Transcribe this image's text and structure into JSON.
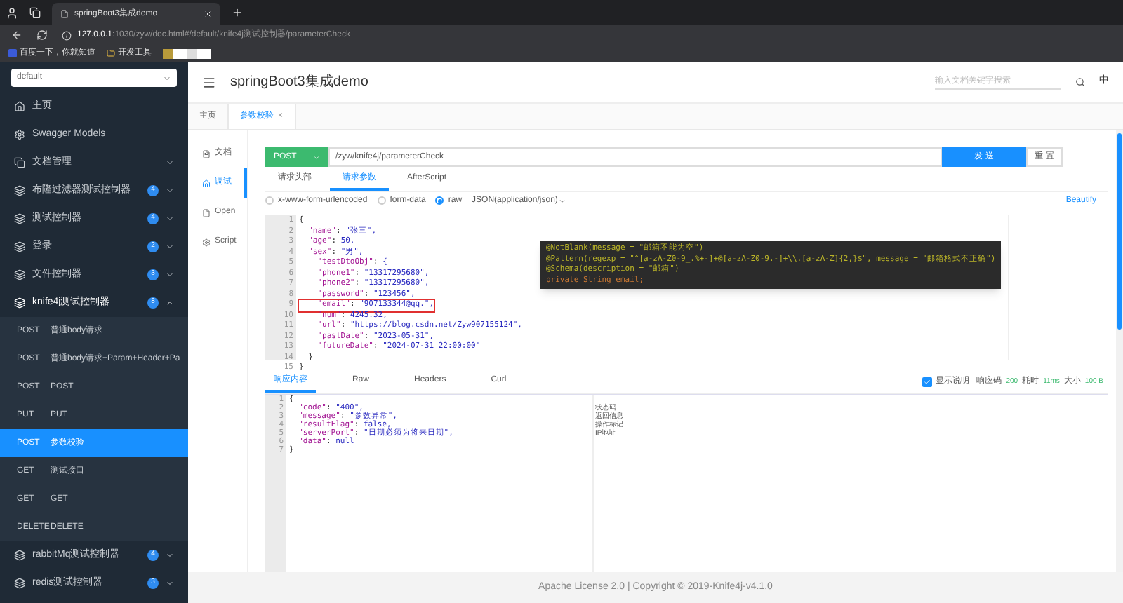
{
  "browser": {
    "tab_title": "springBoot3集成demo",
    "url_host": "127.0.0.1",
    "url_rest": ":1030/zyw/doc.html#/default/knife4j测试控制器/parameterCheck",
    "bookmarks": [
      "百度一下，你就知道",
      "开发工具"
    ]
  },
  "sidebar": {
    "group_select": "default",
    "items": [
      {
        "kind": "page",
        "label": "主页"
      },
      {
        "kind": "page",
        "label": "Swagger Models"
      },
      {
        "kind": "folder",
        "label": "文档管理",
        "expanded": false
      },
      {
        "kind": "group",
        "label": "布隆过滤器测试控制器",
        "badge": "4",
        "expanded": false
      },
      {
        "kind": "group",
        "label": "测试控制器",
        "badge": "4",
        "expanded": false
      },
      {
        "kind": "group",
        "label": "登录",
        "badge": "2",
        "expanded": false
      },
      {
        "kind": "group",
        "label": "文件控制器",
        "badge": "3",
        "expanded": false
      },
      {
        "kind": "group",
        "label": "knife4j测试控制器",
        "badge": "8",
        "expanded": true,
        "children": [
          {
            "method": "POST",
            "label": "普通body请求",
            "selected": false
          },
          {
            "method": "POST",
            "label": "普通body请求+Param+Header+Pa",
            "selected": false
          },
          {
            "method": "POST",
            "label": "POST",
            "selected": false
          },
          {
            "method": "PUT",
            "label": "PUT",
            "selected": false
          },
          {
            "method": "POST",
            "label": "参数校验",
            "selected": true
          },
          {
            "method": "GET",
            "label": "测试接口",
            "selected": false
          },
          {
            "method": "GET",
            "label": "GET",
            "selected": false
          },
          {
            "method": "DELETE",
            "label": "DELETE",
            "selected": false
          }
        ]
      },
      {
        "kind": "group",
        "label": "rabbitMq测试控制器",
        "badge": "4",
        "expanded": false
      },
      {
        "kind": "group",
        "label": "redis测试控制器",
        "badge": "3",
        "expanded": false
      }
    ]
  },
  "header": {
    "title": "springBoot3集成demo",
    "search_placeholder": "输入文档关键字搜索",
    "lang": "中"
  },
  "page_tabs": [
    {
      "label": "主页",
      "selected": false,
      "closable": false
    },
    {
      "label": "参数校验",
      "selected": true,
      "closable": true
    }
  ],
  "close_mark": "×",
  "side_nav": [
    {
      "label": "文档",
      "selected": false
    },
    {
      "label": "调试",
      "selected": true
    },
    {
      "label": "Open",
      "selected": false
    },
    {
      "label": "Script",
      "selected": false
    }
  ],
  "request": {
    "method": "POST",
    "path": "/zyw/knife4j/parameterCheck",
    "send": "发 送",
    "reset": "重 置",
    "tabs": [
      {
        "label": "请求头部",
        "selected": false
      },
      {
        "label": "请求参数",
        "selected": true
      },
      {
        "label": "AfterScript",
        "selected": false
      }
    ],
    "body_types": [
      {
        "label": "x-www-form-urlencoded",
        "selected": false
      },
      {
        "label": "form-data",
        "selected": false
      },
      {
        "label": "raw",
        "selected": true
      }
    ],
    "content_type": "JSON(application/json)",
    "beautify": "Beautify",
    "lines": [
      {
        "no": "1",
        "text": "{",
        "highlighted": false
      },
      {
        "no": "2",
        "text": "  \"name\": \"张三\",",
        "highlighted": false
      },
      {
        "no": "3",
        "text": "  \"age\": 50,",
        "highlighted": false
      },
      {
        "no": "4",
        "text": "  \"sex\": \"男\",",
        "highlighted": false
      },
      {
        "no": "5",
        "text": "    \"testDtoObj\": {",
        "highlighted": false
      },
      {
        "no": "6",
        "text": "    \"phone1\": \"13317295680\",",
        "highlighted": false
      },
      {
        "no": "7",
        "text": "    \"phone2\": \"13317295680\",",
        "highlighted": false
      },
      {
        "no": "8",
        "text": "    \"password\": \"123456\",",
        "highlighted": false
      },
      {
        "no": "9",
        "text": "    \"email\": \"907133344@qq.\",",
        "highlighted": true
      },
      {
        "no": "10",
        "text": "    \"num\": 4245.32,",
        "highlighted": false
      },
      {
        "no": "11",
        "text": "    \"url\": \"https://blog.csdn.net/Zyw907155124\",",
        "highlighted": false
      },
      {
        "no": "12",
        "text": "    \"pastDate\": \"2023-05-31\",",
        "highlighted": false
      },
      {
        "no": "13",
        "text": "    \"futureDate\": \"2024-07-31 22:00:00\"",
        "highlighted": false
      },
      {
        "no": "14",
        "text": "  }",
        "highlighted": false
      },
      {
        "no": "15",
        "text": "}",
        "highlighted": false
      }
    ],
    "annotation": [
      "@NotBlank(message = \"邮箱不能为空\")",
      "@Pattern(regexp = \"^[a-zA-Z0-9_.%+-]+@[a-zA-Z0-9.-]+\\\\.[a-zA-Z]{2,}$\", message = \"邮箱格式不正确\")",
      "@Schema(description = \"邮箱\")",
      "private String email;"
    ]
  },
  "response": {
    "tabs": [
      {
        "label": "响应内容",
        "selected": true
      },
      {
        "label": "Raw",
        "selected": false
      },
      {
        "label": "Headers",
        "selected": false
      },
      {
        "label": "Curl",
        "selected": false
      }
    ],
    "show_desc": {
      "label": "显示说明",
      "checked": true
    },
    "meta": [
      {
        "label": "响应码",
        "value": "200"
      },
      {
        "label": "耗时",
        "value": "11ms"
      },
      {
        "label": "大小",
        "value": "100 B"
      }
    ],
    "lines": [
      {
        "no": "1",
        "text": "{"
      },
      {
        "no": "2",
        "text": "  \"code\": \"400\",",
        "desc": "状态码"
      },
      {
        "no": "3",
        "text": "  \"message\": \"参数异常\",",
        "desc": "返回信息"
      },
      {
        "no": "4",
        "text": "  \"resultFlag\": false,",
        "desc": "操作标记"
      },
      {
        "no": "5",
        "text": "  \"serverPort\": \"日期必须为将来日期\",",
        "desc": "IP地址"
      },
      {
        "no": "6",
        "text": "  \"data\": null"
      },
      {
        "no": "7",
        "text": "}"
      }
    ]
  },
  "footer": "Apache License 2.0 | Copyright © 2019-Knife4j-v4.1.0"
}
